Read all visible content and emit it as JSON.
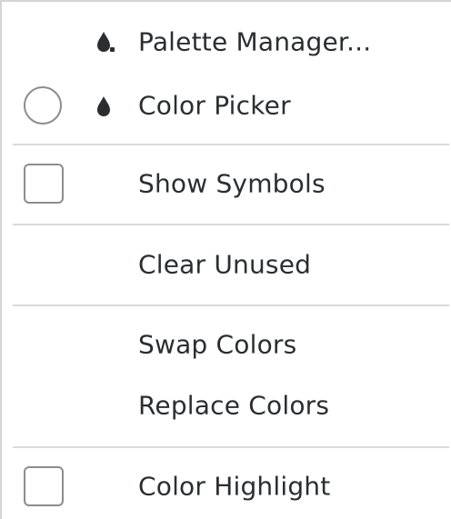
{
  "menu": {
    "items": [
      {
        "label": "Palette Manager...",
        "icon": "palette-drop-icon"
      },
      {
        "label": "Color Picker",
        "icon": "color-drop-icon",
        "control": "radio"
      },
      {
        "label": "Show Symbols",
        "control": "checkbox"
      },
      {
        "label": "Clear Unused"
      },
      {
        "label": "Swap Colors"
      },
      {
        "label": "Replace Colors"
      },
      {
        "label": "Color Highlight",
        "control": "checkbox"
      }
    ]
  },
  "colors": {
    "text": "#2b2e31",
    "separator": "#d9dadb",
    "control_border": "#8b8d8f",
    "background": "#ffffff"
  }
}
